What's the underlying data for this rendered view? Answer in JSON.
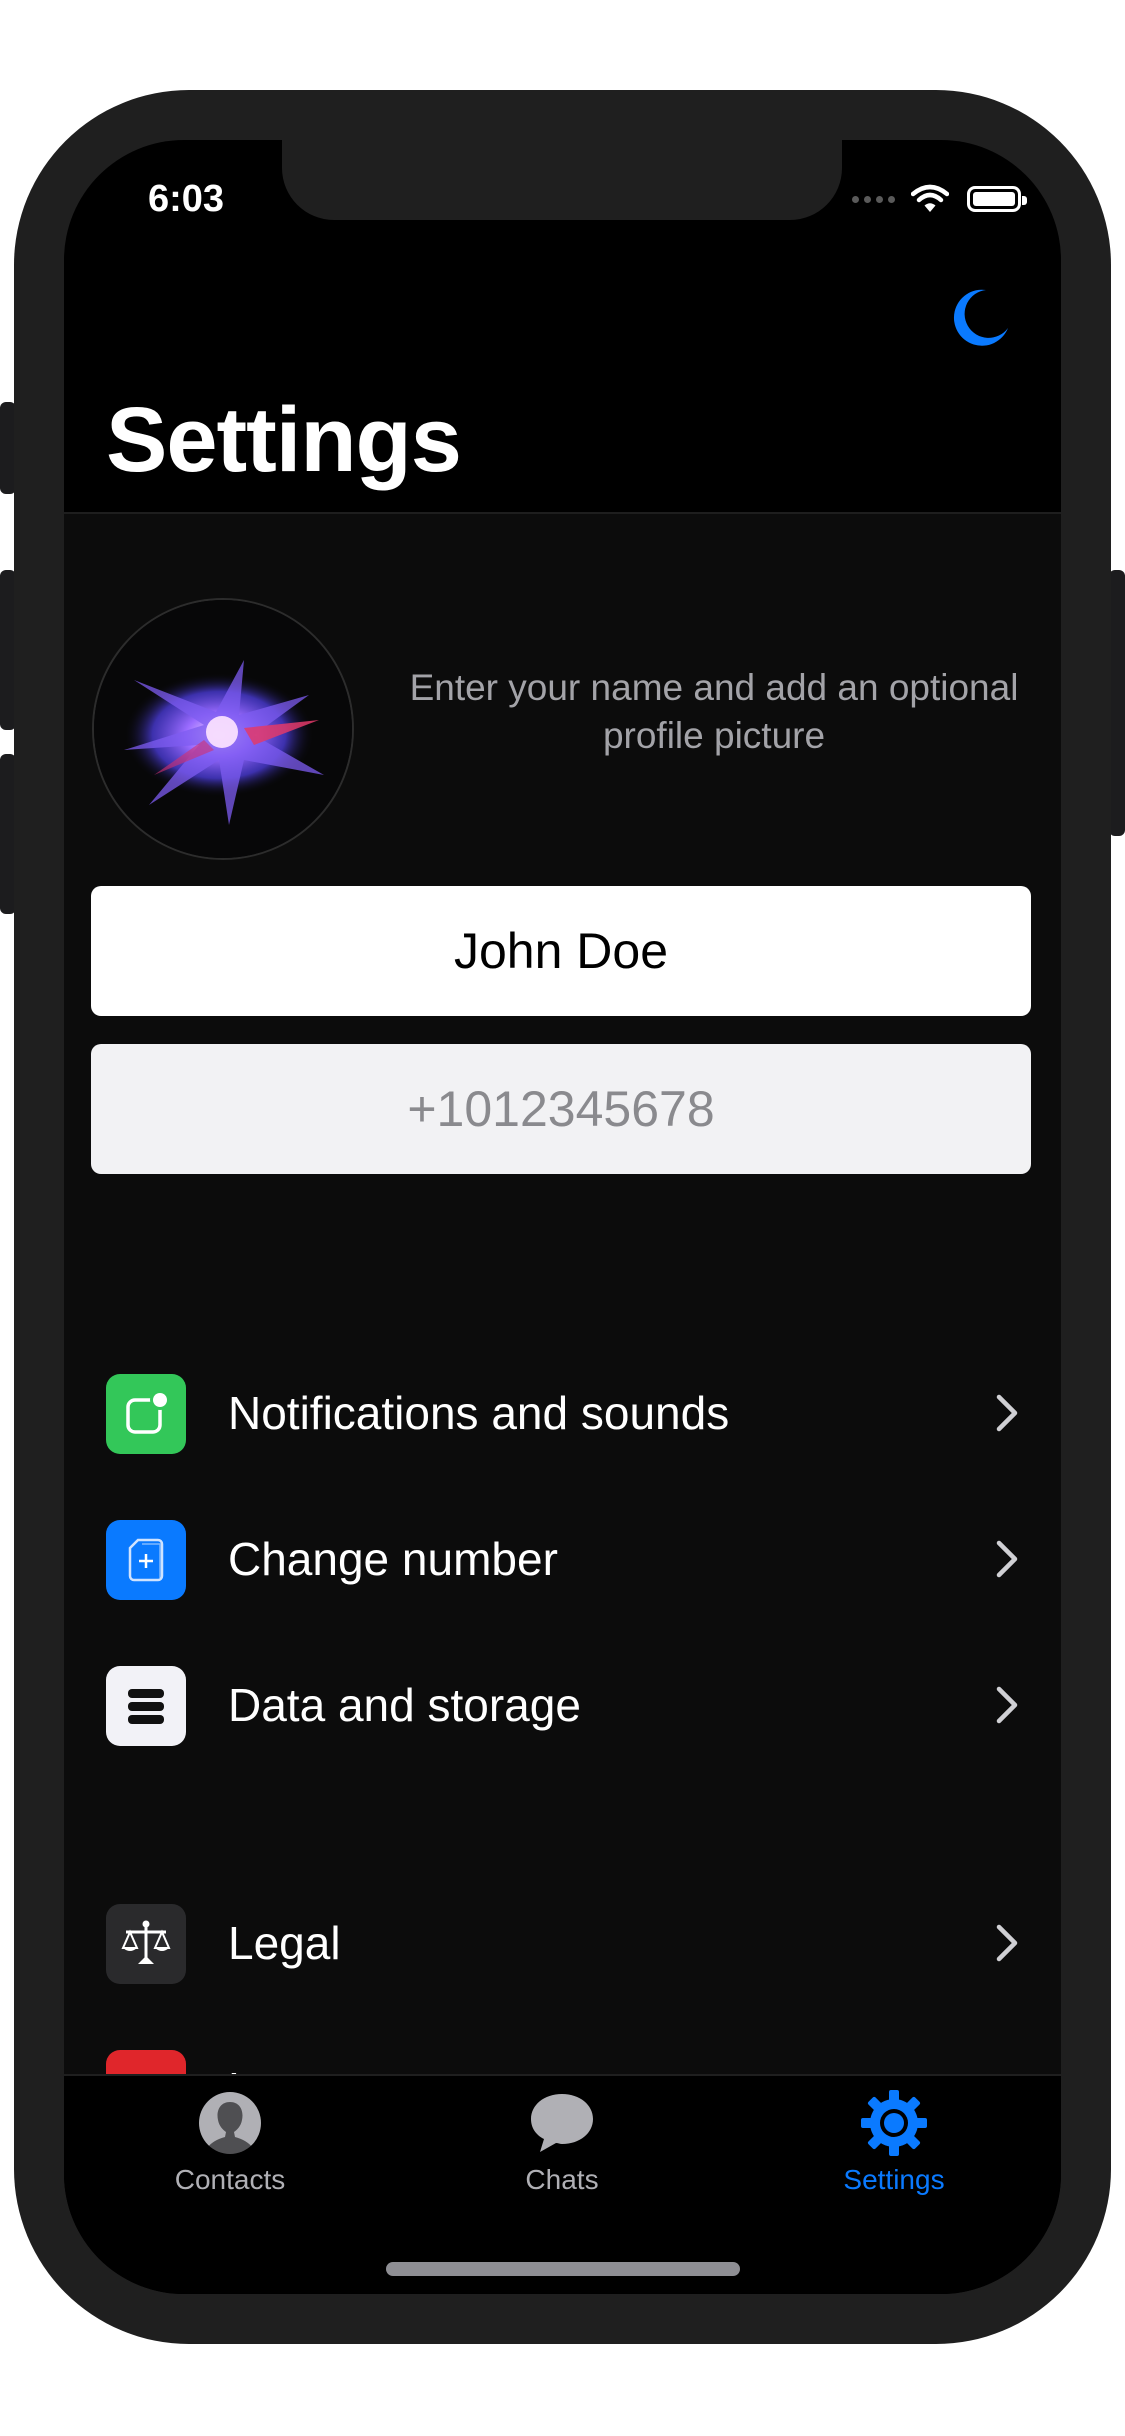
{
  "status_bar": {
    "time": "6:03"
  },
  "header": {
    "title": "Settings",
    "theme_toggle_icon": "moon-icon",
    "accent": "#0a7aff"
  },
  "profile": {
    "hint": "Enter your name and add an optional profile picture",
    "name_value": "John Doe",
    "phone_value": "+1012345678"
  },
  "menu": {
    "items": [
      {
        "label": "Notifications and sounds",
        "icon": "notification-badge-icon",
        "icon_bg": "#33c759"
      },
      {
        "label": "Change number",
        "icon": "sim-card-icon",
        "icon_bg": "#0a7aff"
      },
      {
        "label": "Data and storage",
        "icon": "storage-icon",
        "icon_bg": "#f2f2f7"
      },
      {
        "label": "Legal",
        "icon": "scales-icon",
        "icon_bg": "#2a2a2c"
      },
      {
        "label": "Log out",
        "icon": "logout-icon",
        "icon_bg": "#e0262b"
      }
    ]
  },
  "tabbar": {
    "tabs": [
      {
        "label": "Contacts",
        "icon": "contacts-icon",
        "active": false
      },
      {
        "label": "Chats",
        "icon": "chat-bubble-icon",
        "active": false
      },
      {
        "label": "Settings",
        "icon": "gear-icon",
        "active": true
      }
    ],
    "active_color": "#0a7aff",
    "inactive_color": "#b0b0b5"
  }
}
